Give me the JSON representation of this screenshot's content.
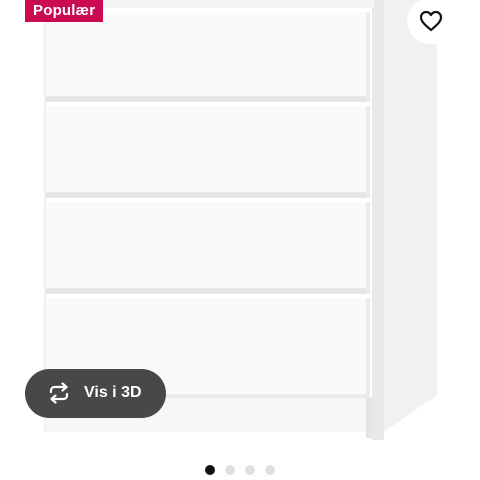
{
  "badge": {
    "label": "Populær"
  },
  "favorite": {
    "icon": "heart-icon"
  },
  "view3d": {
    "label": "Vis i 3D",
    "icon": "rotate-3d-icon"
  },
  "product_image": {
    "subject": "white-4-drawer-chest"
  },
  "pager": {
    "total": 4,
    "active_index": 0
  },
  "colors": {
    "badge_bg": "#cc0a52",
    "button_bg": "#484848",
    "dot_active": "#111111",
    "dot_inactive": "#dfdfdf"
  }
}
